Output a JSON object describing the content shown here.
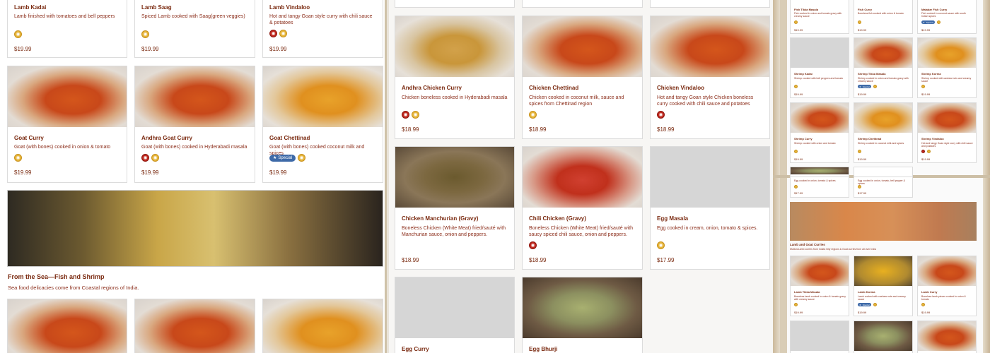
{
  "icons": {
    "mild": "mild-spice-icon",
    "hot": "hot-spice-icon",
    "special": "star-icon"
  },
  "pane1": {
    "row1": [
      {
        "name": "Lamb Kadai",
        "desc": "Lamb finished with tomatoes and bell peppers",
        "price": "$19.99"
      },
      {
        "name": "Lamb Saag",
        "desc": "Spiced Lamb cooked with Saag(green veggies)",
        "price": "$19.99"
      },
      {
        "name": "Lamb Vindaloo",
        "desc": "Hot and tangy Goan style curry with chili sauce & potatoes",
        "price": "$19.99"
      }
    ],
    "row2": [
      {
        "name": "Goat Curry",
        "desc": "Goat (with bones) cooked in onion & tomato",
        "price": "$19.99"
      },
      {
        "name": "Andhra Goat Curry",
        "desc": "Goat (with bones) cooked in Hyderabadi masala",
        "price": "$19.99"
      },
      {
        "name": "Goat Chettinad",
        "desc": "Goat (with bones) cooked coconut milk and spices",
        "price": "$19.99",
        "badge": "Special"
      }
    ],
    "section": {
      "title": "From the Sea—Fish and Shrimp",
      "subtitle": "Sea food delicacies come from Coastal regions of India."
    }
  },
  "pane2": {
    "row1": [
      {
        "name": "Andhra Chicken Curry",
        "desc": "Chicken boneless cooked in Hyderabadi masala",
        "price": "$18.99"
      },
      {
        "name": "Chicken Chettinad",
        "desc": "Chicken cooked in coconut milk, sauce and spices from Chettinad region",
        "price": "$18.99"
      },
      {
        "name": "Chicken Vindaloo",
        "desc": "Hot and tangy Goan style Chicken boneless curry cooked with chili sauce and potatoes",
        "price": "$18.99"
      }
    ],
    "row2": [
      {
        "name": "Chicken Manchurian (Gravy)",
        "desc": "Boneless Chicken (White Meat) fried/sauté with Manchurian sauce, onion and peppers.",
        "price": "$18.99"
      },
      {
        "name": "Chili Chicken (Gravy)",
        "desc": "Boneless Chicken (White Meat) fried/sauté with saucy spiced chili sauce, onion and peppers.",
        "price": "$18.99"
      },
      {
        "name": "Egg Masala",
        "desc": "Egg cooked in cream, onion, tomato & spices.",
        "price": "$17.99"
      }
    ],
    "row3": [
      {
        "name": "Egg Curry"
      },
      {
        "name": "Egg Bhurji"
      }
    ]
  },
  "pane3": {
    "top": {
      "row0": [
        {
          "name": "Fish Tikka Masala",
          "desc": "Fish cooked in onion and tomato gravy with creamy sauce",
          "price": "$19.99"
        },
        {
          "name": "Fish Curry",
          "desc": "Boneless fish cooked with onion & tomato",
          "price": "$19.99"
        },
        {
          "name": "Malabar Fish Curry",
          "desc": "Fish cooked in coconut sauce with south Indian spices",
          "price": "$19.99",
          "badge": "Special"
        }
      ],
      "row1": [
        {
          "name": "Shrimp Kadai",
          "desc": "Shrimp cooked with bell peppers and tomato",
          "price": "$19.99"
        },
        {
          "name": "Shrimp Tikka Masala",
          "desc": "Shrimp cooked in onion and tomato gravy with creamy sauce",
          "price": "$19.99",
          "badge": "Special"
        },
        {
          "name": "Shrimp Korma",
          "desc": "Shrimp cooked with cashew nuts and creamy sauce",
          "price": "$19.99"
        }
      ],
      "row2": [
        {
          "name": "Shrimp Curry",
          "desc": "Shrimp cooked with onion and tomato",
          "price": "$19.99"
        },
        {
          "name": "Shrimp Chettinad",
          "desc": "Shrimp cooked in coconut milk and spices",
          "price": "$19.99"
        },
        {
          "name": "Shrimp Vindaloo",
          "desc": "Hot and tangy Goan style curry with chili sauce and potatoes",
          "price": "$19.99"
        }
      ],
      "row3": [
        {
          "desc": "Egg cooked in onion, tomato & spices",
          "price": "$17.99"
        },
        {
          "desc": "Egg cooked in onion, tomato, bell pepper & spices",
          "price": "$17.99"
        }
      ]
    },
    "bottom": {
      "section": {
        "title": "Lamb and Goat Curries",
        "subtitle": "Mutton/Lamb curries from Indian hilly regions & Goat curries from all over India"
      },
      "row1": [
        {
          "name": "Lamb Tikka Masala",
          "desc": "Boneless lamb cooked in onion & tomato gravy with creamy sauce",
          "price": "$19.99"
        },
        {
          "name": "Lamb Korma",
          "desc": "Lamb cooked with cashew nuts and creamy sauce",
          "price": "$19.99",
          "badge": "Special"
        },
        {
          "name": "Lamb Curry",
          "desc": "Boneless lamb pieces cooked in onion & tomato",
          "price": "$19.99"
        }
      ]
    }
  }
}
